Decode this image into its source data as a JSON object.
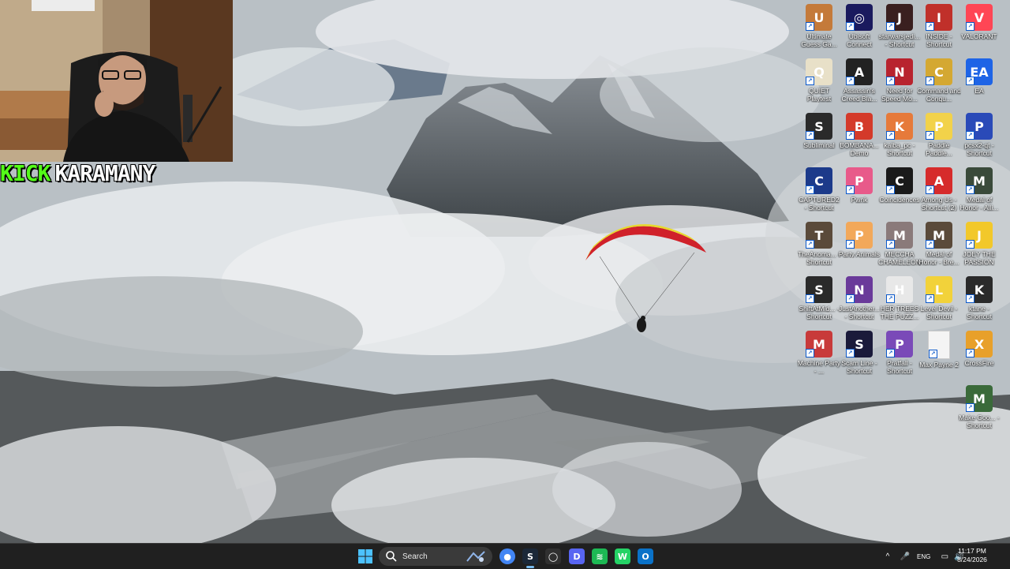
{
  "stream": {
    "platform": "KICK",
    "streamer": "KARAMANY"
  },
  "desktop_icons": [
    {
      "label": "Ultimate Guess Ga...",
      "icon": "game-icon",
      "color": "#c47a3a",
      "glyph": "U"
    },
    {
      "label": "Ubisoft Connect",
      "icon": "ubisoft-icon",
      "color": "#1a1a5e",
      "glyph": "◎"
    },
    {
      "label": "starwarsjedi... - Shortcut",
      "icon": "star-wars-icon",
      "color": "#3a1f1f",
      "glyph": "J"
    },
    {
      "label": "INSIDE - Shortcut",
      "icon": "inside-icon",
      "color": "#c0302a",
      "glyph": "I"
    },
    {
      "label": "VALORANT",
      "icon": "valorant-icon",
      "color": "#ff4655",
      "glyph": "V"
    },
    {
      "label": "QUIET Playtest",
      "icon": "quiet-icon",
      "color": "#e8e0c8",
      "glyph": "Q"
    },
    {
      "label": "Assassin's Creed Bla...",
      "icon": "assassins-creed-icon",
      "color": "#222222",
      "glyph": "A"
    },
    {
      "label": "Need for Speed Mo...",
      "icon": "nfs-icon",
      "color": "#b8232e",
      "glyph": "N"
    },
    {
      "label": "Command and Conqu...",
      "icon": "command-conquer-icon",
      "color": "#d4a832",
      "glyph": "C"
    },
    {
      "label": "EA",
      "icon": "ea-icon",
      "color": "#1e64e6",
      "glyph": "EA"
    },
    {
      "label": "Subliminal",
      "icon": "subliminal-icon",
      "color": "#2a2a2a",
      "glyph": "S"
    },
    {
      "label": "BOMBANA... Demo",
      "icon": "bombana-icon",
      "color": "#d43a2a",
      "glyph": "B"
    },
    {
      "label": "kaiba_pc - Shortcut",
      "icon": "kaiba-icon",
      "color": "#e67a3a",
      "glyph": "K"
    },
    {
      "label": "Paddle Paddle...",
      "icon": "paddle-icon",
      "color": "#f2d24a",
      "glyph": "P"
    },
    {
      "label": "pcsx2-qt - Shortcut",
      "icon": "pcsx2-icon",
      "color": "#2a4ab8",
      "glyph": "P"
    },
    {
      "label": "CAPTURED2 - Shortcut",
      "icon": "captured-icon",
      "color": "#1c3a8a",
      "glyph": "C"
    },
    {
      "label": "Pwnk",
      "icon": "pwnk-icon",
      "color": "#e85a8a",
      "glyph": "P"
    },
    {
      "label": "Coincidences",
      "icon": "coincidences-icon",
      "color": "#1a1a1a",
      "glyph": "C"
    },
    {
      "label": "Among Us - Shortcut (2)",
      "icon": "among-us-icon",
      "color": "#d62b2b",
      "glyph": "A"
    },
    {
      "label": "Medal of Honor - Alli...",
      "icon": "medal-of-honor-icon",
      "color": "#3a4a3a",
      "glyph": "M"
    },
    {
      "label": "TheAnoma... - Shortcut",
      "icon": "anomaly-icon",
      "color": "#5a4a3a",
      "glyph": "T"
    },
    {
      "label": "Party Animals",
      "icon": "party-animals-icon",
      "color": "#f2a85a",
      "glyph": "P"
    },
    {
      "label": "MECCHA CHAMELEON",
      "icon": "chameleon-icon",
      "color": "#8a7a7a",
      "glyph": "M"
    },
    {
      "label": "Medal of Honor - Bre...",
      "icon": "medal-of-honor-icon",
      "color": "#5a4a3a",
      "glyph": "M"
    },
    {
      "label": "JOEY THE PASSION",
      "icon": "joey-icon",
      "color": "#f2c82a",
      "glyph": "J"
    },
    {
      "label": "ShiftAtMid... - Shortcut",
      "icon": "shift-icon",
      "color": "#2a2a2a",
      "glyph": "S"
    },
    {
      "label": "JustAnother... - Shortcut",
      "icon": "night-shift-icon",
      "color": "#6a3a9a",
      "glyph": "N"
    },
    {
      "label": "HER TREES THE PUZZ...",
      "icon": "trees-icon",
      "color": "#e8e8e8",
      "glyph": "H"
    },
    {
      "label": "Level Devil - Shortcut",
      "icon": "level-devil-icon",
      "color": "#f2d23a",
      "glyph": "L"
    },
    {
      "label": "ktane - Shortcut",
      "icon": "ktane-icon",
      "color": "#2a2a2a",
      "glyph": "K"
    },
    {
      "label": "Machine Party - ...",
      "icon": "machine-party-icon",
      "color": "#c83a3a",
      "glyph": "M"
    },
    {
      "label": "Scam Line - Shortcut",
      "icon": "scam-line-icon",
      "color": "#1a1a3a",
      "glyph": "S"
    },
    {
      "label": "Pratfall - Shortcut",
      "icon": "pratfall-icon",
      "color": "#7a4ab8",
      "glyph": "P"
    },
    {
      "label": "Max Payne 2",
      "icon": "file-icon",
      "color": "#f4f4f4",
      "glyph": ""
    },
    {
      "label": "CrossFire",
      "icon": "crossfire-icon",
      "color": "#e8a02a",
      "glyph": "X"
    },
    {
      "label": "Make Goo... - Shortcut",
      "icon": "make-goo-icon",
      "color": "#3a6a3a",
      "glyph": "M"
    }
  ],
  "taskbar": {
    "search_label": "Search",
    "apps": [
      {
        "name": "chrome-icon",
        "color": "#4285f4",
        "glyph": "●"
      },
      {
        "name": "steam-icon",
        "color": "#1b2838",
        "glyph": "S"
      },
      {
        "name": "github-icon",
        "color": "#303030",
        "glyph": "◯"
      },
      {
        "name": "discord-icon",
        "color": "#5865f2",
        "glyph": "D"
      },
      {
        "name": "spotify-icon",
        "color": "#1db954",
        "glyph": "≋"
      },
      {
        "name": "whatsapp-icon",
        "color": "#25d366",
        "glyph": "W"
      },
      {
        "name": "outlook-icon",
        "color": "#0a72c8",
        "glyph": "O"
      }
    ],
    "language": "ENG",
    "time": "11:17 PM",
    "date": "8/24/2026"
  }
}
